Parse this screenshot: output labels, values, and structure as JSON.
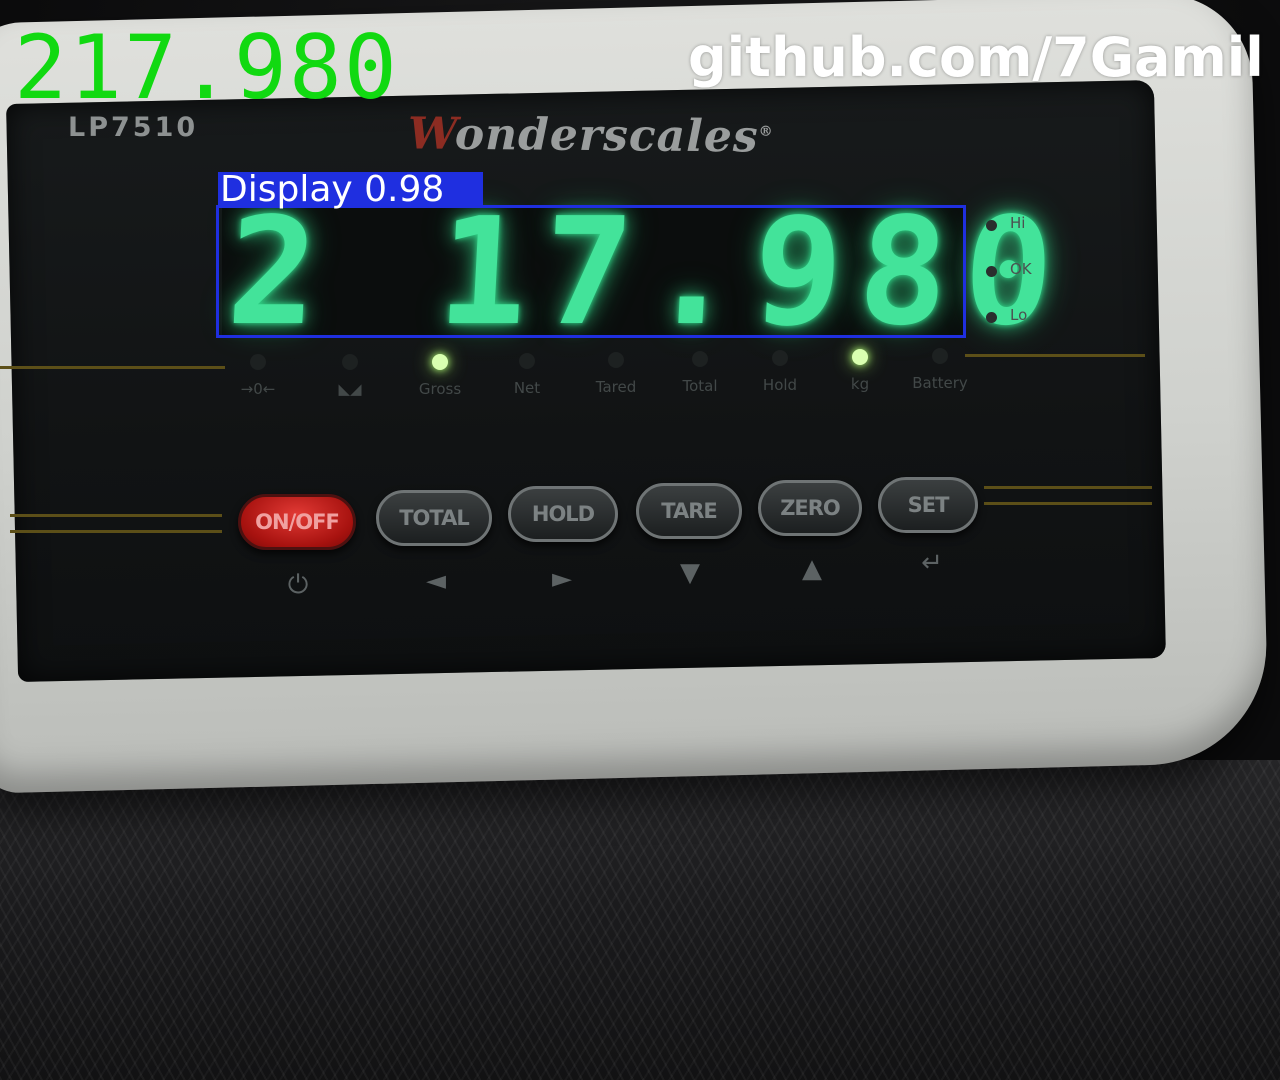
{
  "overlay": {
    "ocr_reading": "217.980",
    "watermark": "github.com/7Gamil",
    "detection_label": "Display",
    "detection_score": "0.98",
    "box_color": "#1f2fe0",
    "ocr_color": "#11d911"
  },
  "device": {
    "model": "LP7510",
    "brand_initial": "W",
    "brand_rest": "onderscales",
    "brand_mark": "®",
    "display_value": "2 17.980",
    "display_color": "#43e39a",
    "side_indicators": [
      "Hi",
      "OK",
      "Lo"
    ],
    "indicators": [
      {
        "label": "→0←",
        "lit": false
      },
      {
        "label": "◣◢",
        "lit": false
      },
      {
        "label": "Gross",
        "lit": true
      },
      {
        "label": "Net",
        "lit": false
      },
      {
        "label": "Tared",
        "lit": false
      },
      {
        "label": "Total",
        "lit": false
      },
      {
        "label": "Hold",
        "lit": false
      },
      {
        "label": "kg",
        "lit": true
      },
      {
        "label": "Battery",
        "lit": false
      }
    ],
    "buttons": [
      {
        "label": "ON/OFF",
        "symbol": "⏻",
        "symbol_icon": "power-icon"
      },
      {
        "label": "TOTAL",
        "symbol": "◄",
        "symbol_icon": "arrow-left-icon"
      },
      {
        "label": "HOLD",
        "symbol": "►",
        "symbol_icon": "arrow-right-icon"
      },
      {
        "label": "TARE",
        "symbol": "▼",
        "symbol_icon": "arrow-down-icon"
      },
      {
        "label": "ZERO",
        "symbol": "▲",
        "symbol_icon": "arrow-up-icon"
      },
      {
        "label": "SET",
        "symbol": "↵",
        "symbol_icon": "enter-icon"
      }
    ]
  }
}
